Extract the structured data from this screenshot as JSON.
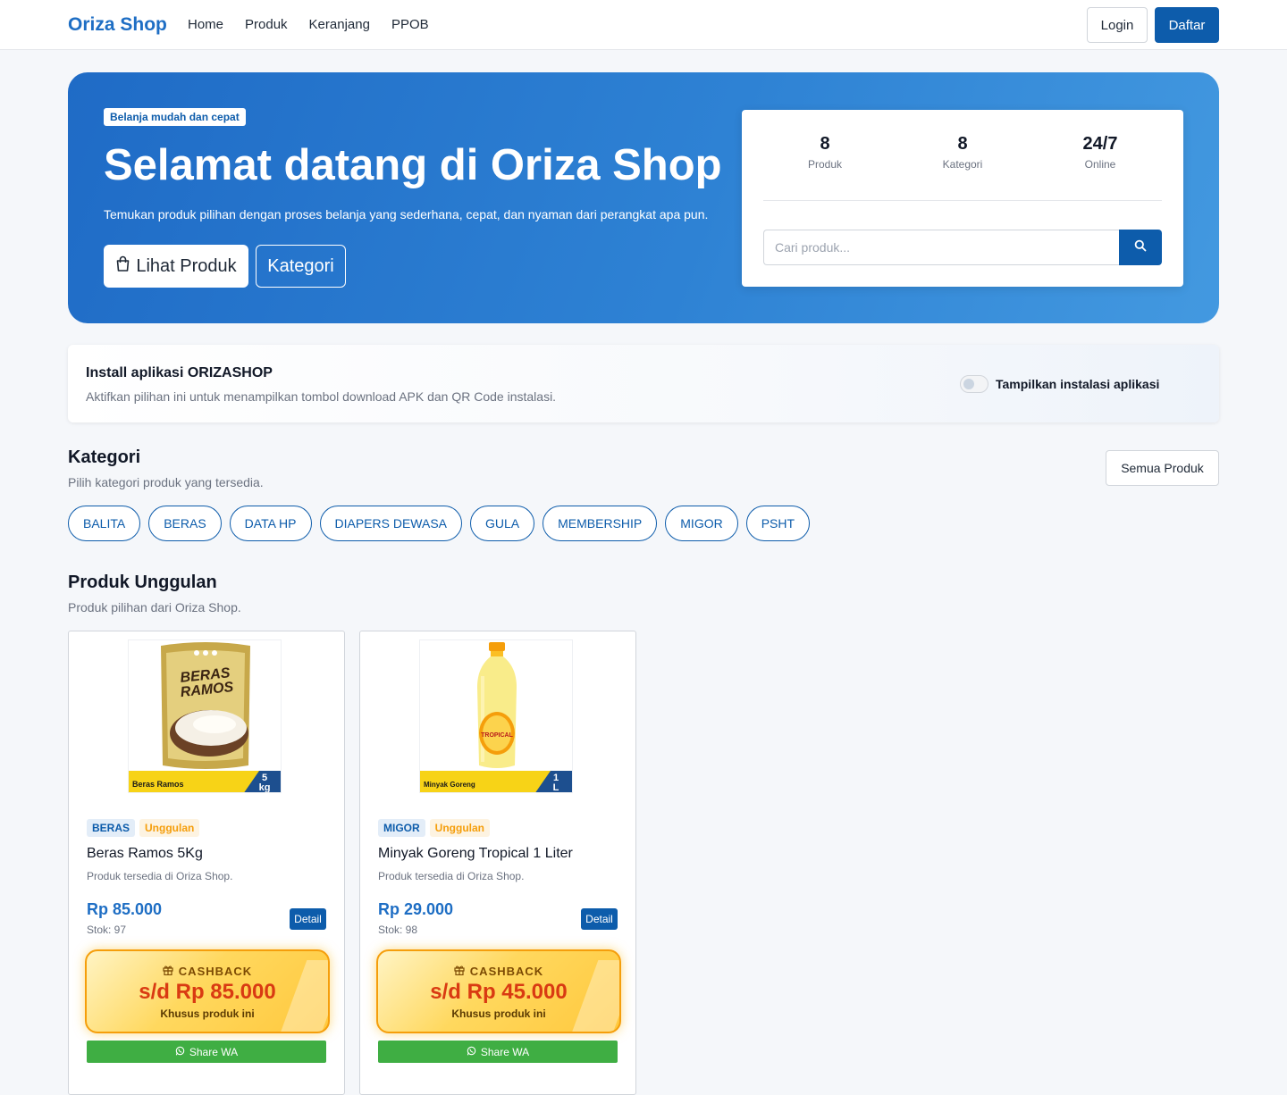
{
  "nav": {
    "brand": "Oriza Shop",
    "links": [
      "Home",
      "Produk",
      "Keranjang",
      "PPOB"
    ],
    "login": "Login",
    "register": "Daftar"
  },
  "hero": {
    "badge": "Belanja mudah dan cepat",
    "title": "Selamat datang di Oriza Shop",
    "subtitle": "Temukan produk pilihan dengan proses belanja yang sederhana, cepat, dan nyaman dari perangkat apa pun.",
    "btn_products": "Lihat Produk",
    "btn_categories": "Kategori",
    "stats": [
      {
        "value": "8",
        "label": "Produk"
      },
      {
        "value": "8",
        "label": "Kategori"
      },
      {
        "value": "24/7",
        "label": "Online"
      }
    ],
    "search_placeholder": "Cari produk..."
  },
  "install": {
    "title": "Install aplikasi ORIZASHOP",
    "desc": "Aktifkan pilihan ini untuk menampilkan tombol download APK dan QR Code instalasi.",
    "toggle_label": "Tampilkan instalasi aplikasi",
    "toggle_on": false
  },
  "categories": {
    "title": "Kategori",
    "subtitle": "Pilih kategori produk yang tersedia.",
    "all_button": "Semua Produk",
    "items": [
      "BALITA",
      "BERAS",
      "DATA HP",
      "DIAPERS DEWASA",
      "GULA",
      "MEMBERSHIP",
      "MIGOR",
      "PSHT"
    ]
  },
  "featured": {
    "title": "Produk Unggulan",
    "subtitle": "Produk pilihan dari Oriza Shop.",
    "products": [
      {
        "category": "BERAS",
        "badge": "Unggulan",
        "name": "Beras Ramos 5Kg",
        "desc": "Produk tersedia di Oriza Shop.",
        "price": "Rp 85.000",
        "stock": "Stok: 97",
        "detail": "Detail",
        "cashback_label": "CASHBACK",
        "cashback_amount": "s/d Rp 85.000",
        "cashback_note": "Khusus produk ini",
        "share": "Share WA",
        "image": {
          "brand_top": "BERAS",
          "brand_bottom": "RAMOS",
          "strip": "Beras Ramos",
          "size_top": "5",
          "size_bottom": "kg"
        }
      },
      {
        "category": "MIGOR",
        "badge": "Unggulan",
        "name": "Minyak Goreng Tropical 1 Liter",
        "desc": "Produk tersedia di Oriza Shop.",
        "price": "Rp 29.000",
        "stock": "Stok: 98",
        "detail": "Detail",
        "cashback_label": "CASHBACK",
        "cashback_amount": "s/d Rp 45.000",
        "cashback_note": "Khusus produk ini",
        "share": "Share WA",
        "image": {
          "label": "TROPICAL",
          "strip": "Minyak Goreng",
          "size_top": "1",
          "size_bottom": "L"
        }
      }
    ]
  },
  "colors": {
    "primary": "#0d5cab",
    "brand": "#1e6ec4",
    "price": "#1e6ec4",
    "featured_badge": "#f59e0b",
    "cashback_amount": "#d93a12",
    "whatsapp": "#3fae43"
  }
}
